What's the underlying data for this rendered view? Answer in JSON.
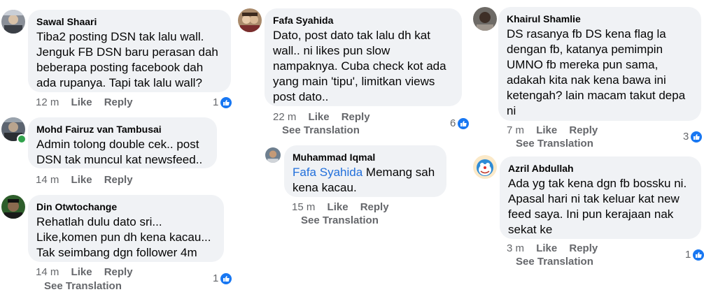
{
  "actions": {
    "like": "Like",
    "reply": "Reply",
    "see_translation": "See Translation"
  },
  "comments": [
    {
      "name": "Sawal Shaari",
      "text": "Tiba2 posting DSN tak lalu wall.\nJenguk FB DSN baru perasan dah\nbeberapa posting facebook dah\nada rupanya. Tapi tak lalu wall?",
      "time": "12 m",
      "reactions": "1"
    },
    {
      "name": "Mohd Fairuz van Tambusai",
      "text": "Admin tolong double cek.. post\nDSN tak muncul kat newsfeed..",
      "time": "14 m"
    },
    {
      "name": "Din Otwtochange",
      "text": "Rehatlah dulu dato sri...\nLike,komen pun dh kena kacau...\nTak seimbang dgn follower 4m",
      "time": "14 m",
      "reactions": "1"
    },
    {
      "name": "Fafa Syahida",
      "text": "Dato, post dato tak lalu dh kat\nwall.. ni likes pun slow\nnampaknya. Cuba check kot ada\nyang main 'tipu', limitkan views\npost dato..",
      "time": "22 m",
      "reactions": "6"
    },
    {
      "name": "Muhammad Iqmal",
      "mention": "Fafa Syahida",
      "text": " Memang sah\nkena kacau.",
      "time": "15 m"
    },
    {
      "name": "Khairul Shamlie",
      "text": "DS rasanya fb DS kena flag la\ndengan fb, katanya pemimpin\nUMNO fb mereka pun sama,\nadakah kita nak kena bawa ini\nketengah? lain macam takut depa\nni",
      "time": "7 m",
      "reactions": "3"
    },
    {
      "name": "Azril Abdullah",
      "text": "Ada yg tak kena dgn fb bossku ni.\nApasal hari ni tak keluar kat  new\nfeed saya. Ini pun kerajaan nak\nsekat ke",
      "time": "3 m",
      "reactions": "1"
    }
  ],
  "colors": {
    "bubble": "#f0f2f5",
    "meta": "#65676b",
    "like_badge": "#1877f2",
    "mention": "#216fdb",
    "online": "#31a24c"
  }
}
